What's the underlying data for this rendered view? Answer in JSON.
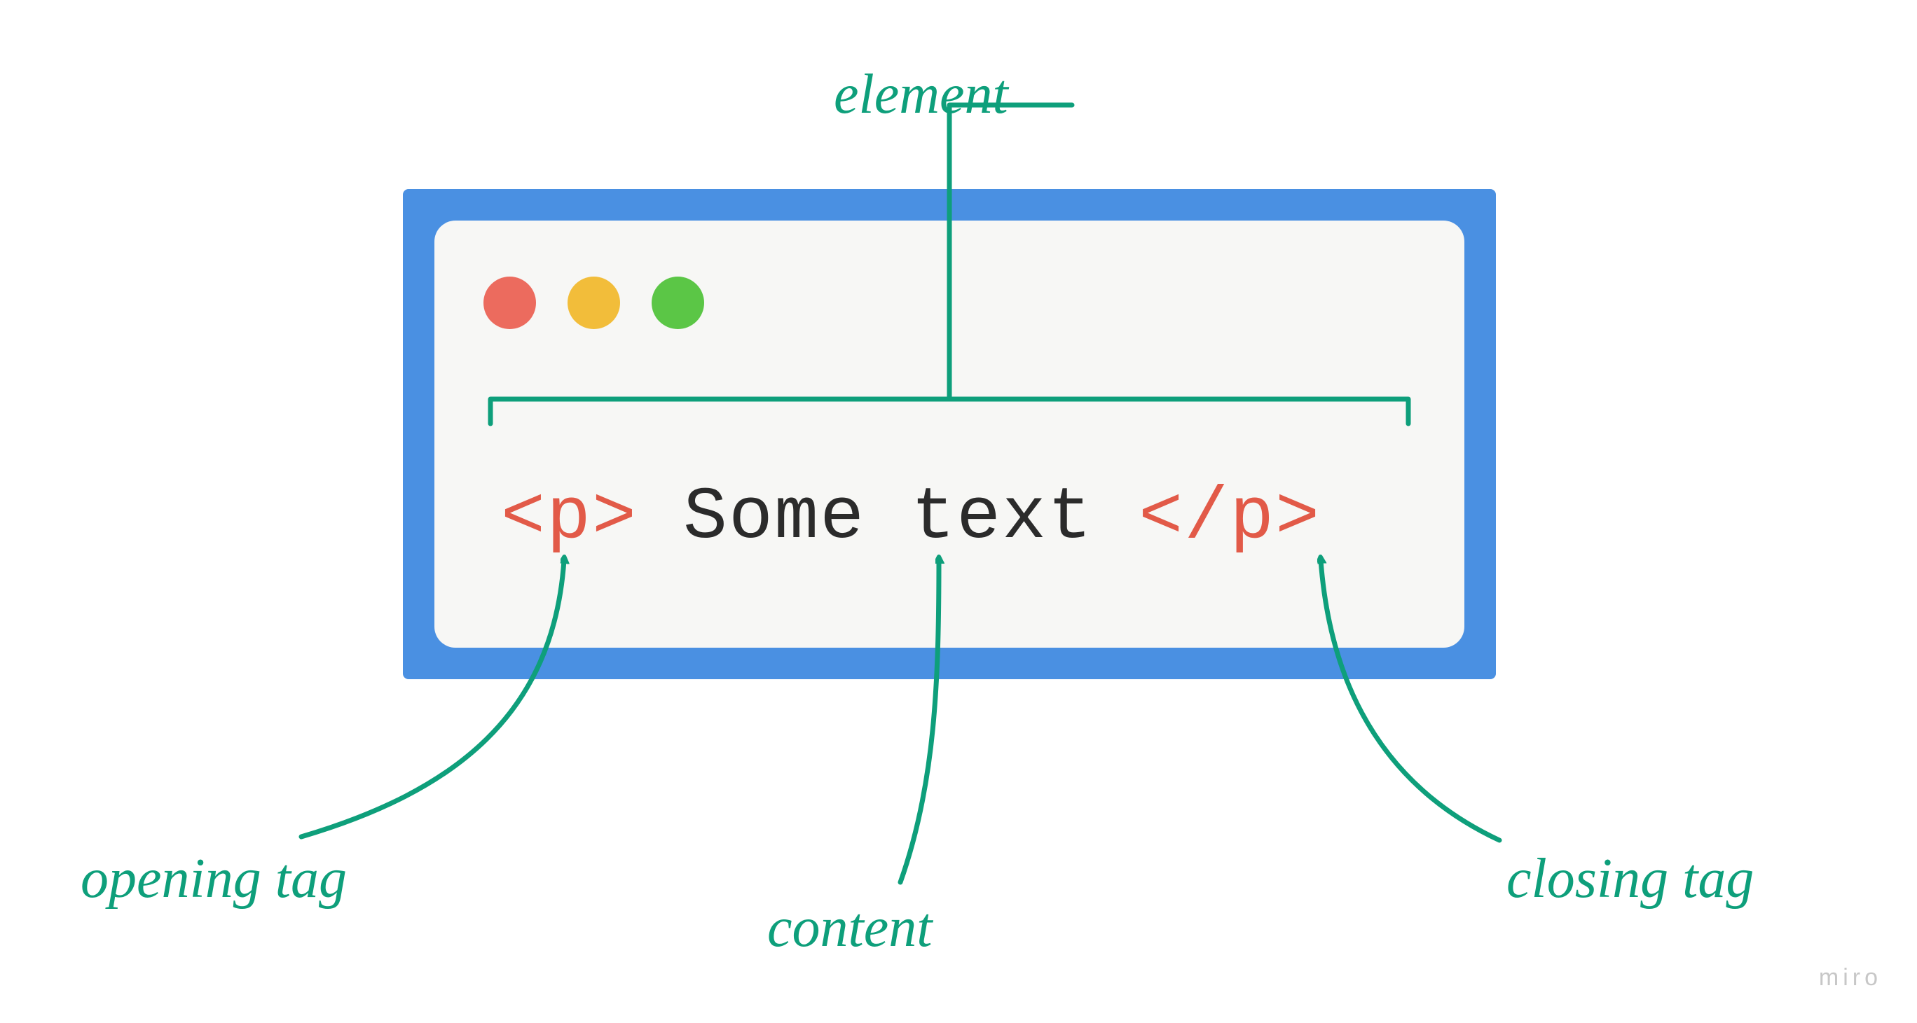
{
  "labels": {
    "element": "element",
    "opening_tag": "opening tag",
    "content": "content",
    "closing_tag": "closing tag"
  },
  "code": {
    "open_tag": "<p>",
    "content": "Some text",
    "close_tag": "</p>"
  },
  "colors": {
    "frame": "#4a90e2",
    "panel": "#f7f7f5",
    "annotation": "#0e9f7b",
    "tag": "#e25a48",
    "text": "#2b2b2b",
    "traffic_light": {
      "red": "#ec6b5e",
      "yellow": "#f2bd3a",
      "green": "#5bc646"
    }
  },
  "watermark": "miro"
}
